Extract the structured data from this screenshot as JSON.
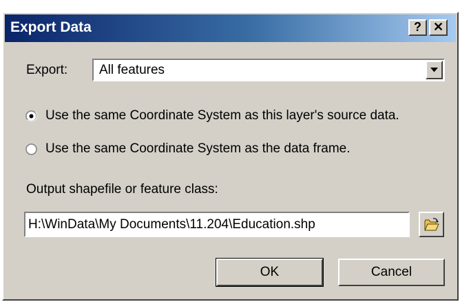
{
  "window": {
    "title": "Export Data",
    "help_label": "?",
    "close_label": "✕"
  },
  "export": {
    "label": "Export:",
    "selected": "All features"
  },
  "coordinate_options": [
    {
      "label": "Use the same Coordinate System as this layer's source data.",
      "selected": true
    },
    {
      "label": "Use the same Coordinate System as the data frame.",
      "selected": false
    }
  ],
  "output": {
    "label": "Output shapefile or feature class:",
    "value": "H:\\WinData\\My Documents\\11.204\\Education.shp",
    "browse_icon": "open-folder-icon"
  },
  "buttons": {
    "ok": "OK",
    "cancel": "Cancel"
  }
}
